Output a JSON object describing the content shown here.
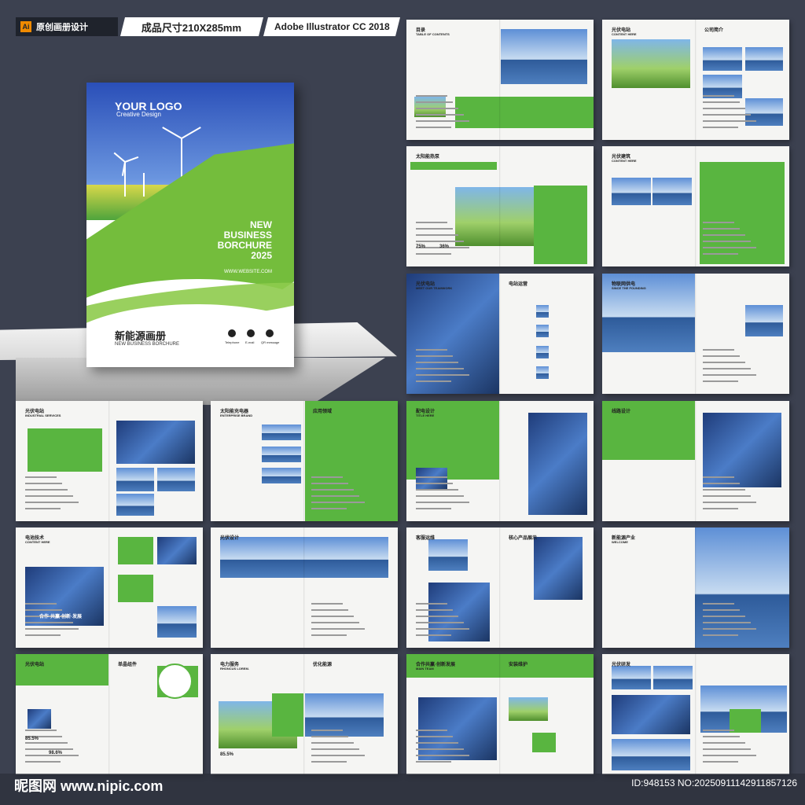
{
  "top_bar": {
    "app_icon": "Ai",
    "title": "原创画册设计",
    "size": "成品尺寸210X285mm",
    "software": "Adobe Illustrator CC 2018"
  },
  "cover": {
    "logo": "YOUR LOGO",
    "logo_sub": "Creative Design",
    "title_lines": [
      "NEW",
      "BUSINESS",
      "BORCHURE",
      "2025"
    ],
    "website": "WWW.WEBSITE.COM",
    "cn_title": "新能源画册",
    "en_title": "NEW BUSINESS BORCHURE",
    "contacts": [
      "Telephone",
      "E-mail",
      "QR message"
    ]
  },
  "spreads": [
    {
      "title": "目录",
      "sub": "TABLE OF CONTENTS"
    },
    {
      "title": "光伏电站",
      "sub": "CONTENT HERE",
      "title2": "公司简介"
    },
    {
      "title": "太阳能热泵",
      "sub": "",
      "stats": [
        "75%",
        "36%"
      ]
    },
    {
      "title": "光伏建筑",
      "sub": "CONTENT HERE"
    },
    {
      "title": "光伏电站",
      "sub": "MEET OUR TEAMWORK",
      "title2": "电站运营"
    },
    {
      "title": "物联网供电",
      "sub": "SINCE THE FOUNDING"
    },
    {
      "title": "光伏电站",
      "sub": "INDUSTRIAL SERVICES"
    },
    {
      "title": "太阳能充电器",
      "sub": "ENTERPRISE BRAND",
      "title2": "应用领域"
    },
    {
      "title": "配电设计",
      "sub": "TITLE HERE"
    },
    {
      "title": "线路设计",
      "sub": ""
    },
    {
      "title": "电池技术",
      "sub": "CONTENT HERE",
      "banner": "合作·共赢·创新·发展"
    },
    {
      "title": "光伏设计",
      "sub": ""
    },
    {
      "title": "客服运维",
      "sub": "",
      "title2": "核心产品展示"
    },
    {
      "title": "新能源产业",
      "sub": "WELCOME"
    },
    {
      "title": "光伏电站",
      "sub": "",
      "title2": "单晶组件",
      "stats": [
        "85.5%",
        "98.6%"
      ]
    },
    {
      "title": "电力服务",
      "sub": "RHONCUS LOREM.",
      "title2": "优化能源",
      "stats": [
        "85.5%"
      ]
    },
    {
      "title": "合作共赢·创新发展",
      "sub": "MAIN TEAM",
      "title2": "安装维护"
    },
    {
      "title": "光伏研发",
      "sub": ""
    }
  ],
  "watermark": "昵图网 www.nipic.com",
  "image_id": "ID:948153 NO:20250911142911857126",
  "colors": {
    "accent": "#59b540",
    "background": "#3c4150"
  }
}
